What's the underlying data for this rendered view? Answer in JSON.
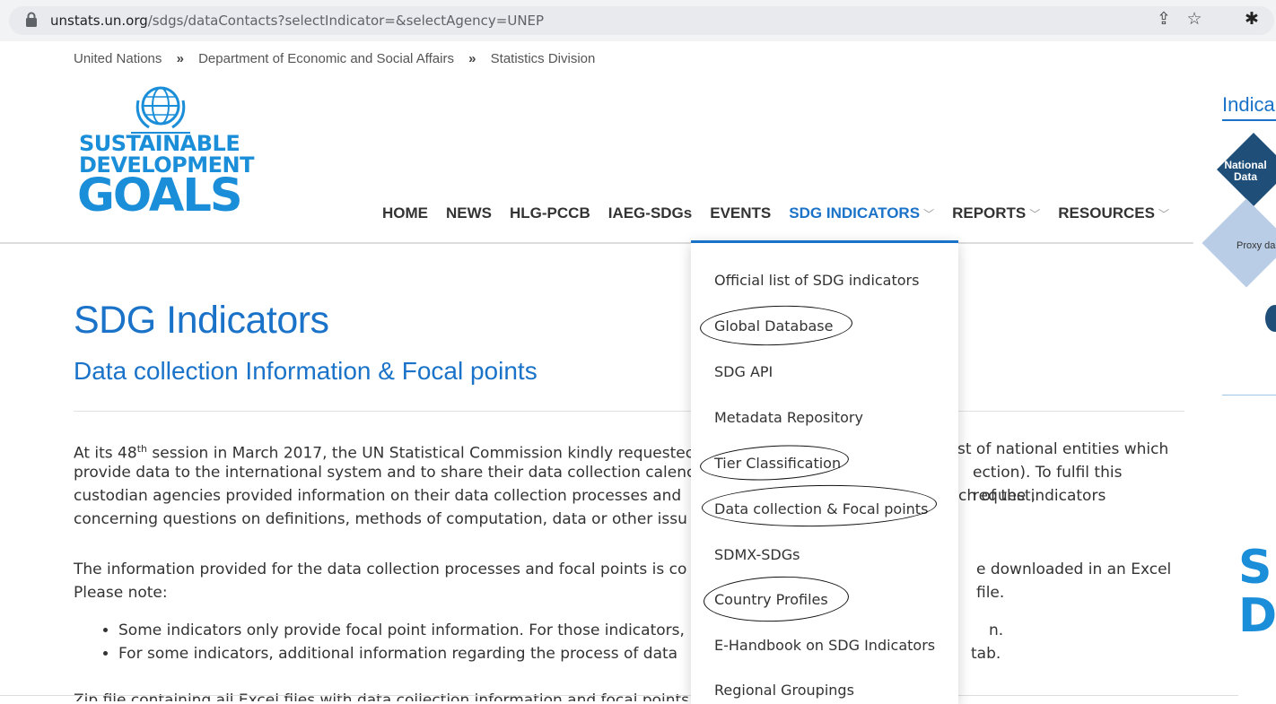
{
  "browser": {
    "url_host": "unstats.un.org",
    "url_path": "/sdgs/dataContacts?selectIndicator=&selectAgency=UNEP"
  },
  "breadcrumb": [
    "United Nations",
    "Department of Economic and Social Affairs",
    "Statistics Division"
  ],
  "breadcrumb_separator": "»",
  "logo": {
    "line1": "SUSTAINABLE",
    "line2": "DEVELOPMENT",
    "line3": "GOALS"
  },
  "nav": {
    "items": [
      {
        "label": "HOME",
        "dropdown": false
      },
      {
        "label": "NEWS",
        "dropdown": false
      },
      {
        "label": "HLG-PCCB",
        "dropdown": false
      },
      {
        "label": "IAEG-SDGs",
        "dropdown": false
      },
      {
        "label": "EVENTS",
        "dropdown": false
      },
      {
        "label": "SDG INDICATORS",
        "dropdown": true,
        "active": true
      },
      {
        "label": "REPORTS",
        "dropdown": true
      },
      {
        "label": "RESOURCES",
        "dropdown": true
      }
    ]
  },
  "page": {
    "title": "SDG Indicators",
    "subtitle": "Data collection Information & Focal points",
    "para1_a": "At its 48",
    "para1_sup": "th",
    "para1_b": " session in March 2017, the UN Statistical Commission kindly requestec",
    "para1_c": "st of national entities which",
    "para1_line2_a": "provide data to the international system and to share their data collection calenc",
    "para1_line2_b": "ection). To fulfil this request,",
    "para1_line3_a": "custodian agencies provided information on their data collection processes and",
    "para1_line3_b": "ch of the indicators",
    "para1_line4": "concerning questions on definitions, methods of computation, data or other issu",
    "para2_a": "The information provided for the data collection processes and focal points is co",
    "para2_b": "e downloaded in an Excel file.",
    "para2_line2": "Please note:",
    "bullet1_a": "Some indicators only provide focal point information. For those indicators,",
    "bullet1_b": "n.",
    "bullet2_a": "For some indicators, additional information regarding the process of data",
    "bullet2_b": "tab.",
    "cutoff_line": "Zip file containing all Excel files with data collection information and focal points"
  },
  "dropdown": {
    "items": [
      "Official list of SDG indicators",
      "Global Database",
      "SDG API",
      "Metadata Repository",
      "Tier Classification",
      "Data collection & Focal points",
      "SDMX-SDGs",
      "Country Profiles",
      "E-Handbook on SDG Indicators",
      "Regional Groupings"
    ]
  },
  "right_panel": {
    "title": "Indica",
    "diamond1": "National Data",
    "diamond2": "Proxy da",
    "letters": [
      "S",
      "D"
    ]
  },
  "colors": {
    "accent": "#1a73c8",
    "logo": "#1a8ed8",
    "dark_blue": "#1f4e79"
  }
}
